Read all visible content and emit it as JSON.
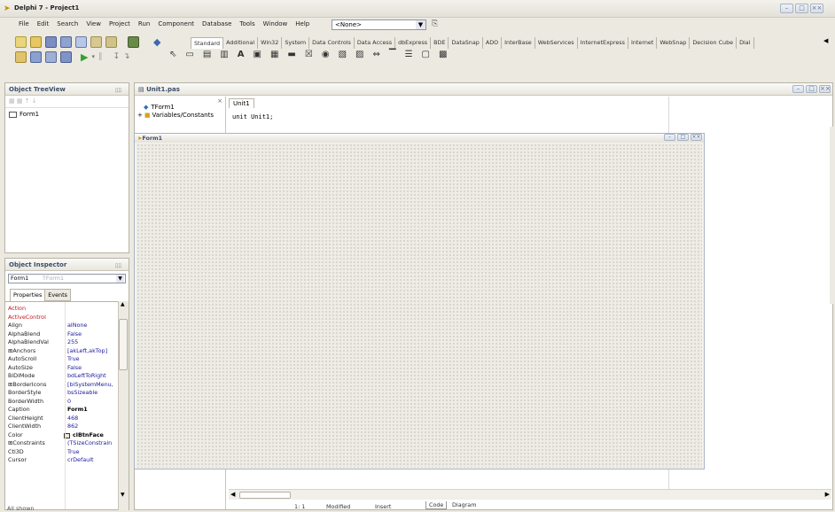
{
  "app": {
    "title": "Delphi 7 - Project1",
    "window_controls": [
      "–",
      "□",
      "××"
    ]
  },
  "menu": {
    "items": [
      "File",
      "Edit",
      "Search",
      "View",
      "Project",
      "Run",
      "Component",
      "Database",
      "Tools",
      "Window",
      "Help"
    ],
    "desktop_combo": "<None>"
  },
  "palette": {
    "tabs": [
      "Standard",
      "Additional",
      "Win32",
      "System",
      "Data Controls",
      "Data Access",
      "dbExpress",
      "BDE",
      "DataSnap",
      "ADO",
      "InterBase",
      "WebServices",
      "InternetExpress",
      "Internet",
      "WebSnap",
      "Decision Cube",
      "Dial"
    ],
    "selected": "Standard",
    "scroll_arrow": "◀"
  },
  "tree_view": {
    "title": "Object TreeView",
    "pin": "ﾛﾛ",
    "root": "Form1"
  },
  "inspector": {
    "title": "Object Inspector",
    "pin": "ﾛﾛ",
    "object_name": "Form1",
    "object_type": "TForm1",
    "tabs": [
      "Properties",
      "Events"
    ],
    "properties": [
      {
        "name": "Action",
        "value": "",
        "event": true
      },
      {
        "name": "ActiveControl",
        "value": "",
        "event": true
      },
      {
        "name": "Align",
        "value": "alNone"
      },
      {
        "name": "AlphaBlend",
        "value": "False"
      },
      {
        "name": "AlphaBlendVal",
        "value": "255"
      },
      {
        "name": "⊞Anchors",
        "value": "[akLeft,akTop]"
      },
      {
        "name": "AutoScroll",
        "value": "True"
      },
      {
        "name": "AutoSize",
        "value": "False"
      },
      {
        "name": "BiDiMode",
        "value": "bdLeftToRight"
      },
      {
        "name": "⊞BorderIcons",
        "value": "[biSystemMenu,"
      },
      {
        "name": "BorderStyle",
        "value": "bsSizeable"
      },
      {
        "name": "BorderWidth",
        "value": "0"
      },
      {
        "name": "Caption",
        "value": "Form1",
        "selected": true
      },
      {
        "name": "ClientHeight",
        "value": "468"
      },
      {
        "name": "ClientWidth",
        "value": "862"
      },
      {
        "name": "Color",
        "value": "clBtnFace",
        "bold": true
      },
      {
        "name": "⊞Constraints",
        "value": "(TSizeConstrain"
      },
      {
        "name": "Ctl3D",
        "value": "True"
      },
      {
        "name": "Cursor",
        "value": "crDefault"
      }
    ],
    "footer": "All shown"
  },
  "editor": {
    "file_tab": "Unit1.pas",
    "window_controls": [
      "–",
      "□",
      "××"
    ],
    "close_x": "×",
    "unit_tab": "Unit1",
    "explorer": [
      {
        "label": "TForm1"
      },
      {
        "label": "Variables/Constants",
        "prefix": "+"
      }
    ],
    "code_line": "unit Unit1;"
  },
  "designer": {
    "form_title": "Form1",
    "window_controls": [
      "–",
      "□",
      "××"
    ]
  },
  "status": {
    "position": "1: 1",
    "modified": "Modified",
    "mode": "Insert",
    "tabs": [
      "Code",
      "Diagram"
    ]
  }
}
